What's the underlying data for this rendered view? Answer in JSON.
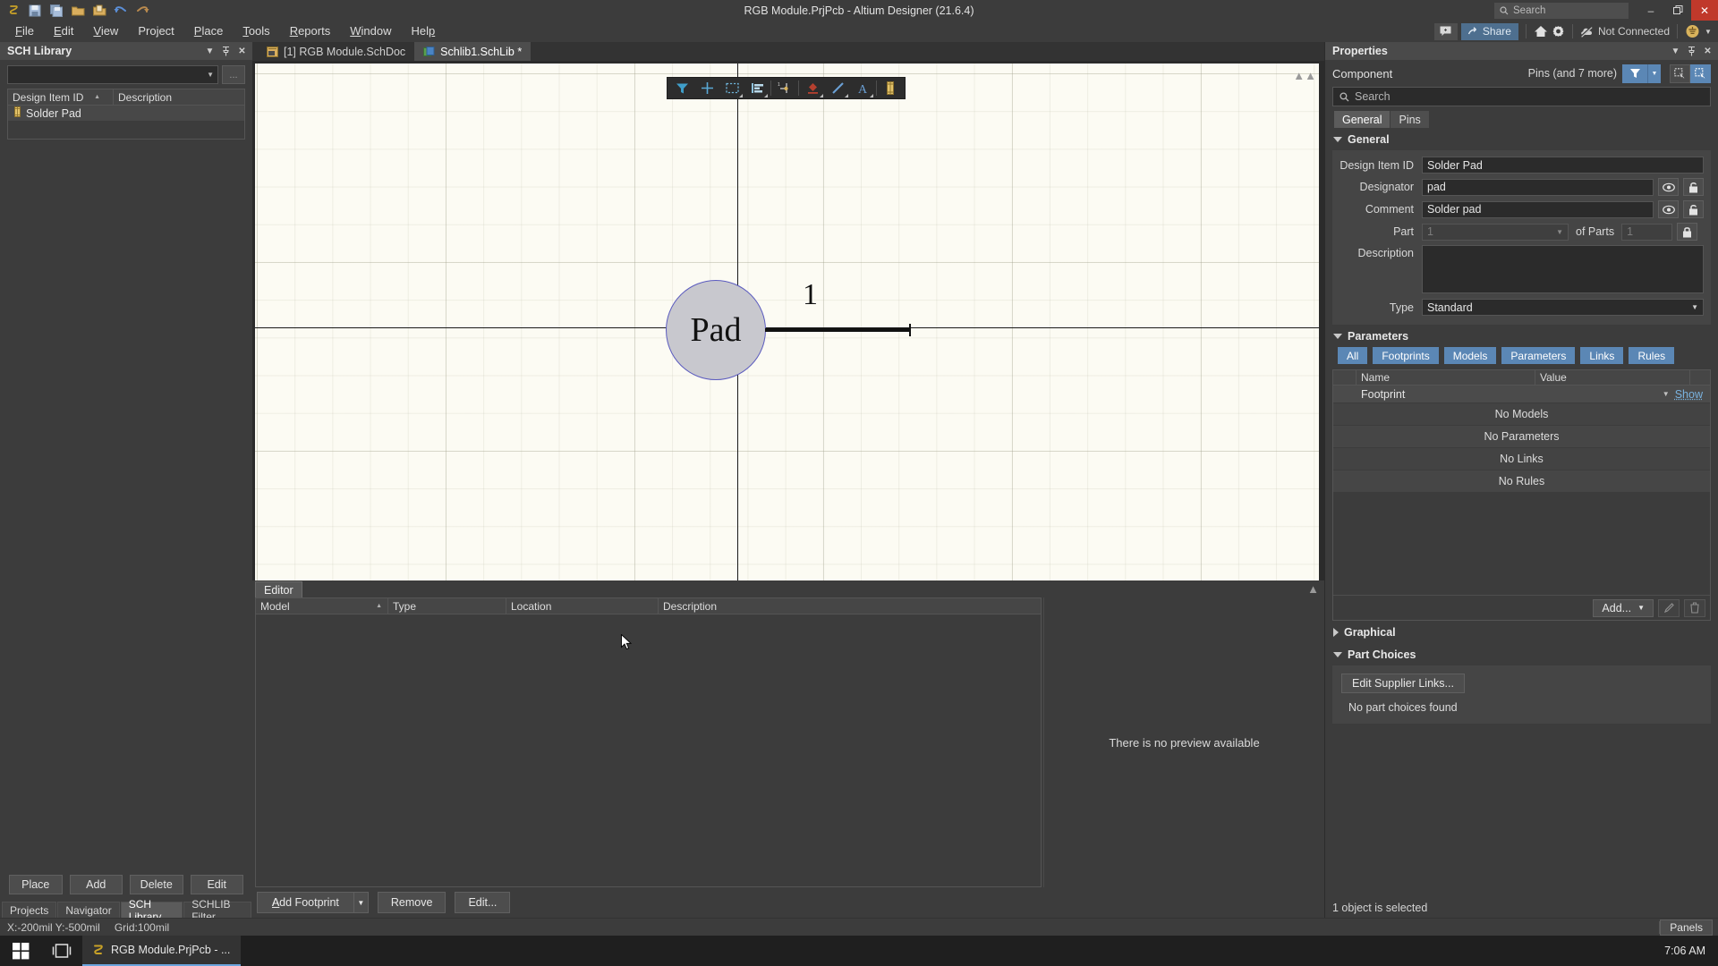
{
  "titlebar": {
    "title": "RGB Module.PrjPcb - Altium Designer (21.6.4)",
    "search_placeholder": "Search",
    "icons": [
      "altium-logo-icon",
      "save-icon",
      "save-all-icon",
      "open-folder-icon",
      "open-project-icon",
      "undo-icon",
      "redo-icon"
    ],
    "minimize": "–",
    "restore": "❐",
    "close": "✕"
  },
  "menubar": {
    "items": [
      "File",
      "Edit",
      "View",
      "Project",
      "Place",
      "Tools",
      "Reports",
      "Window",
      "Help"
    ],
    "share_label": "Share",
    "connection_status": "Not Connected"
  },
  "left_panel": {
    "title": "SCH Library",
    "library_combo_value": "",
    "dots_label": "...",
    "columns": [
      "Design Item ID",
      "Description"
    ],
    "rows": [
      {
        "design_item_id": "Solder Pad",
        "description": ""
      }
    ],
    "buttons": [
      "Place",
      "Add",
      "Delete",
      "Edit"
    ],
    "tabs": [
      "Projects",
      "Navigator",
      "SCH Library",
      "SCHLIB Filter"
    ],
    "active_tab": "SCH Library"
  },
  "doc_tabs": [
    {
      "label": "[1] RGB Module.SchDoc",
      "active": false
    },
    {
      "label": "Schlib1.SchLib *",
      "active": true
    }
  ],
  "canvas": {
    "toolbar_icons": [
      "filter-icon",
      "cross-probe-icon",
      "select-area-icon",
      "align-icon",
      "place-pin-icon",
      "place-ieee-symbol-icon",
      "place-line-icon",
      "place-text-icon",
      "place-part-icon"
    ],
    "pad_label": "Pad",
    "pin_number": "1"
  },
  "editor": {
    "tab_label": "Editor",
    "columns": [
      "Model",
      "Type",
      "Location",
      "Description"
    ],
    "rows": [],
    "preview_message": "There is no preview available",
    "buttons": {
      "add_footprint": "Add Footprint",
      "remove": "Remove",
      "edit": "Edit..."
    }
  },
  "properties": {
    "title": "Properties",
    "object_type": "Component",
    "pins_summary": "Pins (and 7 more)",
    "search_placeholder": "Search",
    "tabs": [
      "General",
      "Pins"
    ],
    "active_tab": "General",
    "general": {
      "header": "General",
      "design_item_id_label": "Design Item ID",
      "design_item_id": "Solder Pad",
      "designator_label": "Designator",
      "designator": "pad",
      "comment_label": "Comment",
      "comment": "Solder pad",
      "part_label": "Part",
      "part": "1",
      "of_parts_label": "of Parts",
      "of_parts": "1",
      "description_label": "Description",
      "description": "",
      "type_label": "Type",
      "type": "Standard"
    },
    "parameters": {
      "header": "Parameters",
      "filters": [
        "All",
        "Footprints",
        "Models",
        "Parameters",
        "Links",
        "Rules"
      ],
      "columns": [
        "Name",
        "Value"
      ],
      "rows": [
        {
          "name": "Footprint",
          "value": "",
          "action": "Show"
        }
      ],
      "empty_messages": [
        "No Models",
        "No Parameters",
        "No Links",
        "No Rules"
      ],
      "add_label": "Add...",
      "edit_icon": "pencil-icon",
      "delete_icon": "trash-icon"
    },
    "graphical": {
      "header": "Graphical"
    },
    "part_choices": {
      "header": "Part Choices",
      "edit_supplier_links": "Edit Supplier Links...",
      "note": "No part choices found"
    },
    "status": "1 object is selected"
  },
  "statusbar": {
    "coordinates": "X:-200mil Y:-500mil",
    "grid": "Grid:100mil",
    "panels_label": "Panels"
  },
  "taskbar": {
    "app_label": "RGB Module.PrjPcb - ...",
    "clock": "7:06 AM"
  },
  "colors": {
    "accent_blue": "#5b87b5",
    "link_blue": "#7ab3e0",
    "close_red": "#c0392b",
    "canvas_bg": "#fcfbf3",
    "pad_fill": "#c8c8ce",
    "pad_stroke": "#5b5bbf"
  }
}
